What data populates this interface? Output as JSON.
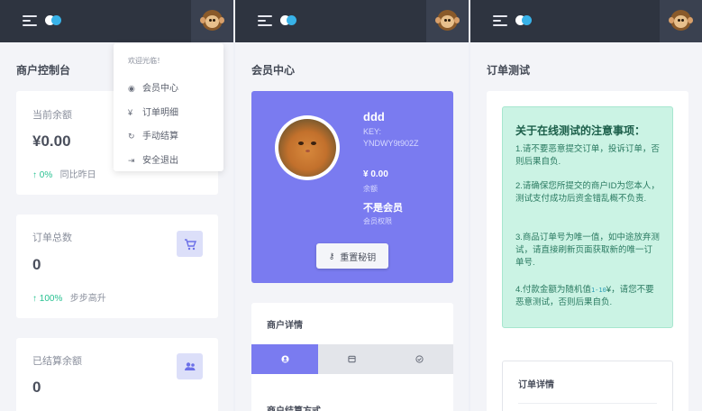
{
  "topbar": {
    "menu_icon": "menu-icon",
    "toggle_icon": "toggle-icon",
    "avatar_icon": "monkey-avatar"
  },
  "dashboard": {
    "title": "商户控制台",
    "balance": {
      "label": "当前余额",
      "value": "¥0.00",
      "trend_pct": "0%",
      "trend_text": "同比昨日"
    },
    "orders": {
      "label": "订单总数",
      "value": "0",
      "trend_pct": "100%",
      "trend_text": "步步高升",
      "icon": "cart-icon"
    },
    "settled": {
      "label": "已结算余额",
      "value": "0",
      "icon": "users-icon"
    }
  },
  "dropdown": {
    "welcome": "欢迎光临！",
    "items": [
      {
        "icon": "user-circle-icon",
        "label": "会员中心"
      },
      {
        "icon": "yen-icon",
        "label": "订单明细"
      },
      {
        "icon": "refresh-icon",
        "label": "手动结算"
      },
      {
        "icon": "logout-icon",
        "label": "安全退出"
      }
    ]
  },
  "member": {
    "title": "会员中心",
    "name": "ddd",
    "key_label": "KEY:",
    "key_value": "YNDWY9t902Z",
    "balance": "¥ 0.00",
    "balance_label": "余额",
    "vip_status": "不是会员",
    "vip_label": "会员权限",
    "reset_button": "重置秘钥",
    "detail_title": "商户详情",
    "tabs": [
      "user-icon",
      "card-icon",
      "check-icon"
    ],
    "detail_sub": "商户结算方式"
  },
  "order_test": {
    "title": "订单测试",
    "notice_title": "关于在线测试的注意事项：",
    "notices": [
      "1.请不要恶意提交订单，投诉订单，否则后果自负.",
      "2.请确保您所提交的商户ID为您本人，测试支付成功后资金错乱概不负责.",
      "3.商品订单号为唯一值，如中途放弃测试，请直接刷新页面获取新的唯一订单号.",
      "4.付款金额为随机值",
      "¥，请您不要恶意测试，否则后果自负."
    ],
    "range": "1-10",
    "detail_title": "订单详情"
  },
  "colors": {
    "accent": "#7a7bf0",
    "topbar": "#2e3440",
    "success": "#28c191",
    "notice_bg": "#cbf3e4"
  }
}
